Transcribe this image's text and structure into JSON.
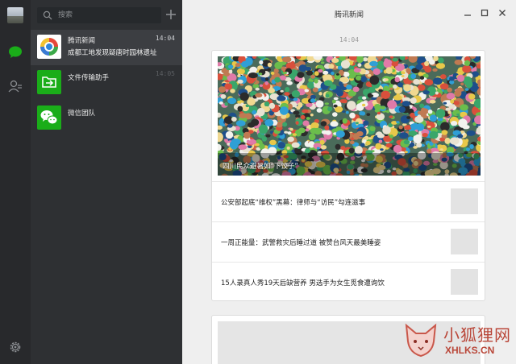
{
  "search": {
    "placeholder": "搜索"
  },
  "window": {
    "title": "腾讯新闻"
  },
  "sessions": [
    {
      "name": "腾讯新闻",
      "time": "14:04",
      "preview": "成都工地发现疑唐时园林遗址",
      "active": true
    },
    {
      "name": "文件传输助手",
      "time": "14:05",
      "preview": ""
    },
    {
      "name": "微信团队",
      "time": "",
      "preview": ""
    }
  ],
  "chat": {
    "timestamp": "14:04",
    "hero_caption": "四川民众避暑如“下饺子”",
    "items": [
      {
        "text": "公安部起底“维权”黑幕：律师与“访民”勾连滋事"
      },
      {
        "text": "一周正能量：武警救灾后睡过道 被赞台风天最美睡姿"
      },
      {
        "text": "15人录真人秀19天后缺营养 男选手为女生觅食遭询饮"
      }
    ]
  },
  "watermark": {
    "cn": "小狐狸网",
    "en": "XHLKS.CN"
  },
  "colors": {
    "sidebar_bg": "#28292c",
    "list_bg": "#2e3033",
    "active_row": "#3c3e42",
    "accent_green": "#1aad19",
    "chat_bg": "#efefef"
  },
  "icons": {
    "chat_tab": "chat-bubble-icon",
    "contacts_tab": "contacts-icon",
    "settings": "gear-icon",
    "search": "search-icon",
    "add": "plus-icon",
    "file_transfer": "file-transfer-icon",
    "wechat_team": "wechat-logo-icon"
  }
}
